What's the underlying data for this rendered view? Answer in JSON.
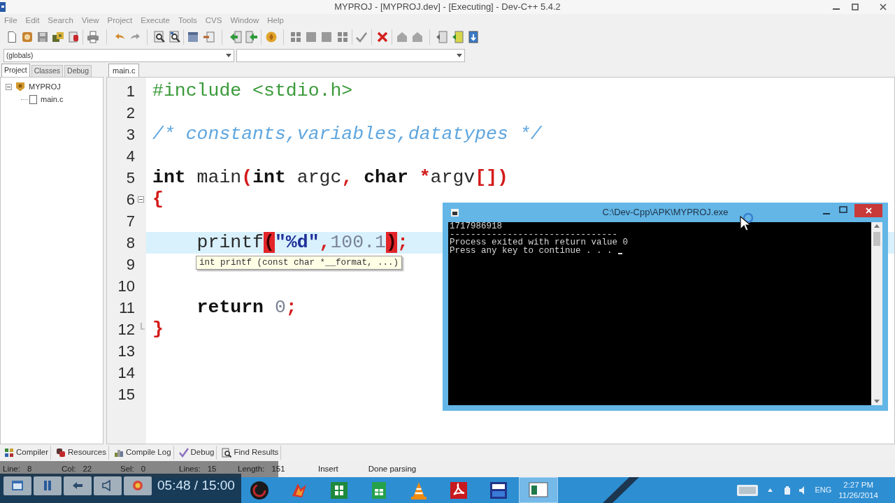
{
  "window": {
    "title": "MYPROJ - [MYPROJ.dev] - [Executing] - Dev-C++ 5.4.2"
  },
  "menu": [
    "File",
    "Edit",
    "Search",
    "View",
    "Project",
    "Execute",
    "Tools",
    "CVS",
    "Window",
    "Help"
  ],
  "scope_bar": {
    "scope": "(globals)"
  },
  "side_panel": {
    "tabs": [
      {
        "label": "Project",
        "selected": true
      },
      {
        "label": "Classes",
        "selected": false
      },
      {
        "label": "Debug",
        "selected": false
      }
    ],
    "tree": [
      {
        "label": "MYPROJ",
        "expanded": true,
        "children": [
          {
            "label": "main.c"
          }
        ]
      }
    ]
  },
  "editor": {
    "tabs": [
      {
        "label": "main.c",
        "selected": true
      }
    ],
    "lines": [
      {
        "number": "1",
        "kind": "plain",
        "current": false,
        "indented": false,
        "tokens": [
          {
            "kind": "preprocessor",
            "text": "#include <stdio.h>"
          }
        ]
      },
      {
        "number": "2",
        "kind": "plain",
        "current": false
      },
      {
        "number": "3",
        "kind": "plain",
        "current": false,
        "indented": false,
        "tokens": [
          {
            "kind": "comment",
            "text": "/* constants,variables,datatypes */"
          }
        ]
      },
      {
        "number": "4",
        "kind": "plain",
        "current": false
      },
      {
        "number": "5",
        "kind": "plain",
        "current": false,
        "indented": false,
        "tokens": [
          {
            "kind": "keyword",
            "text": "int"
          },
          {
            "kind": "plain",
            "text": " main"
          },
          {
            "kind": "symbol",
            "text": "("
          },
          {
            "kind": "keyword",
            "text": "int"
          },
          {
            "kind": "plain",
            "text": " argc"
          },
          {
            "kind": "symbol",
            "text": ", "
          },
          {
            "kind": "keyword",
            "text": "char "
          },
          {
            "kind": "symbol",
            "text": "*"
          },
          {
            "kind": "plain",
            "text": "argv"
          },
          {
            "kind": "symbol",
            "text": "[])"
          }
        ]
      },
      {
        "number": "6",
        "kind": "fold_start",
        "expanded": true,
        "current": false,
        "indented": false,
        "tokens": [
          {
            "kind": "symbol",
            "text": "{"
          }
        ]
      },
      {
        "number": "7",
        "kind": "plain",
        "current": false
      },
      {
        "number": "8",
        "kind": "plain",
        "current": true,
        "indented": true,
        "tokens": [
          {
            "kind": "plain",
            "text": "printf"
          },
          {
            "kind": "matched_bracket",
            "text": "("
          },
          {
            "kind": "string",
            "text": "\"%d\""
          },
          {
            "kind": "symbol",
            "text": ","
          },
          {
            "kind": "number",
            "text": "100.1"
          },
          {
            "kind": "matched_bracket",
            "text": ")"
          },
          {
            "kind": "symbol",
            "text": ";"
          }
        ]
      },
      {
        "number": "9",
        "kind": "plain",
        "current": false
      },
      {
        "number": "10",
        "kind": "plain",
        "current": false
      },
      {
        "number": "11",
        "kind": "plain",
        "current": false,
        "indented": true,
        "tokens": [
          {
            "kind": "keyword",
            "text": "return "
          },
          {
            "kind": "number",
            "text": "0"
          },
          {
            "kind": "symbol",
            "text": ";"
          }
        ]
      },
      {
        "number": "12",
        "kind": "fold_end",
        "current": false,
        "indented": false,
        "tokens": [
          {
            "kind": "symbol",
            "text": "}"
          }
        ]
      },
      {
        "number": "13",
        "kind": "plain",
        "current": false
      },
      {
        "number": "14",
        "kind": "plain",
        "current": false
      },
      {
        "number": "15",
        "kind": "plain",
        "current": false
      }
    ],
    "tooltip": "int printf (const char *__format, ...)"
  },
  "console": {
    "title": "C:\\Dev-Cpp\\APK\\MYPROJ.exe",
    "lines": [
      "1717986918",
      "--------------------------------",
      "Process exited with return value 0",
      "Press any key to continue . . ."
    ]
  },
  "bottom_tabs": [
    {
      "label": "Compiler",
      "selected": false
    },
    {
      "label": "Resources",
      "selected": false
    },
    {
      "label": "Compile Log",
      "selected": false
    },
    {
      "label": "Debug",
      "selected": false
    },
    {
      "label": "Find Results",
      "selected": false
    }
  ],
  "status_bar": {
    "fields": [
      {
        "label": "Line:",
        "value": "8"
      },
      {
        "label": "Col:",
        "value": "22"
      },
      {
        "label": "Sel:",
        "value": "0"
      },
      {
        "label": "Lines:",
        "value": "15"
      },
      {
        "label": "Length:",
        "value": "151"
      }
    ],
    "mode": "Insert",
    "message": "Done parsing"
  },
  "video_player": {
    "time": "05:48 / 15:00"
  },
  "taskbar": {
    "apps": [
      {
        "selected": false
      },
      {
        "selected": false
      },
      {
        "selected": false
      },
      {
        "selected": false
      },
      {
        "selected": false
      },
      {
        "selected": false
      },
      {
        "selected": false
      },
      {
        "selected": true
      }
    ],
    "language": "ENG",
    "time": "2:27 PM",
    "date": "11/26/2014"
  }
}
